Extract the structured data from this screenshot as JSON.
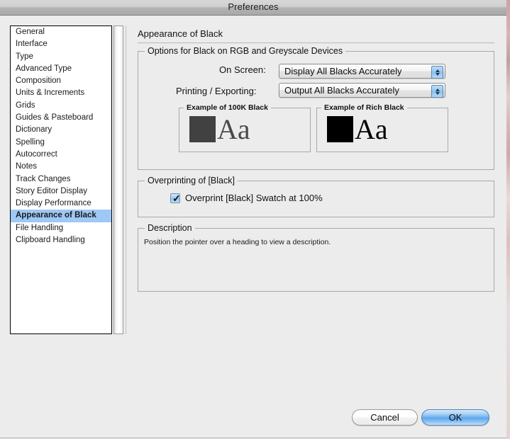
{
  "window": {
    "title": "Preferences"
  },
  "sidebar": {
    "items": [
      {
        "label": "General",
        "selected": false
      },
      {
        "label": "Interface",
        "selected": false
      },
      {
        "label": "Type",
        "selected": false
      },
      {
        "label": "Advanced Type",
        "selected": false
      },
      {
        "label": "Composition",
        "selected": false
      },
      {
        "label": "Units & Increments",
        "selected": false
      },
      {
        "label": "Grids",
        "selected": false
      },
      {
        "label": "Guides & Pasteboard",
        "selected": false
      },
      {
        "label": "Dictionary",
        "selected": false
      },
      {
        "label": "Spelling",
        "selected": false
      },
      {
        "label": "Autocorrect",
        "selected": false
      },
      {
        "label": "Notes",
        "selected": false
      },
      {
        "label": "Track Changes",
        "selected": false
      },
      {
        "label": "Story Editor Display",
        "selected": false
      },
      {
        "label": "Display Performance",
        "selected": false
      },
      {
        "label": "Appearance of Black",
        "selected": true
      },
      {
        "label": "File Handling",
        "selected": false
      },
      {
        "label": "Clipboard Handling",
        "selected": false
      }
    ],
    "selected_label": "Appearance of Black",
    "selection_color": "#9ec8f5"
  },
  "pane": {
    "title": "Appearance of Black",
    "options_group": {
      "legend": "Options for Black on RGB and Greyscale Devices",
      "on_screen": {
        "label": "On Screen:",
        "value": "Display All Blacks Accurately"
      },
      "printing_exporting": {
        "label": "Printing / Exporting:",
        "value": "Output All Blacks Accurately"
      },
      "example_100k": {
        "legend": "Example of 100K Black",
        "swatch_color": "#414141",
        "sample_text": "Aa",
        "text_color": "#4a4a4a"
      },
      "example_rich": {
        "legend": "Example of Rich Black",
        "swatch_color": "#000000",
        "sample_text": "Aa",
        "text_color": "#000000"
      }
    },
    "overprint_group": {
      "legend": "Overprinting of [Black]",
      "checkbox_label": "Overprint [Black] Swatch at 100%",
      "checked": true,
      "check_glyph": "✓"
    },
    "description_group": {
      "legend": "Description",
      "text": "Position the pointer over a heading to view a description."
    }
  },
  "buttons": {
    "cancel": "Cancel",
    "ok": "OK",
    "default_button_color": "#59a4ea"
  }
}
